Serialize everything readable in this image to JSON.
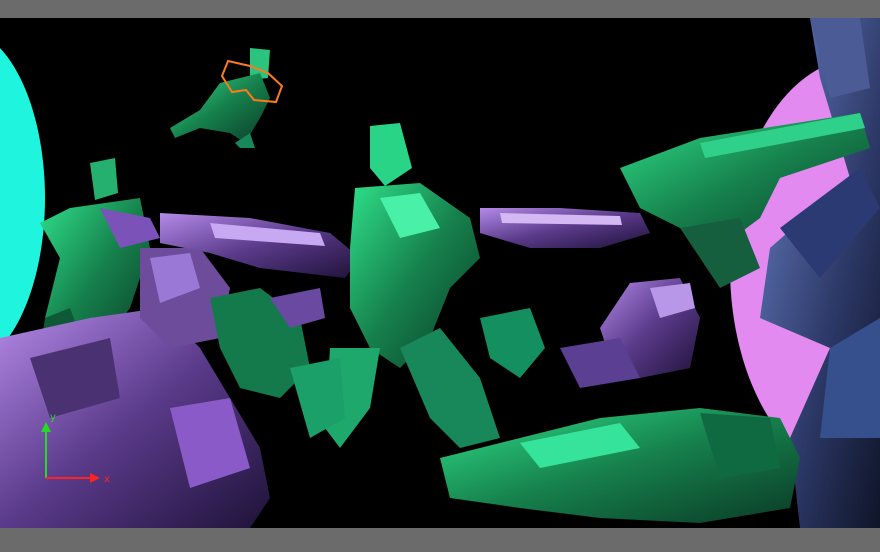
{
  "viewport": {
    "background": "#000000",
    "letterbox_color": "#6b6b6b"
  },
  "scene": {
    "left_disc_color": "#1ff5de",
    "right_disc_color": "#e28af0",
    "figure_green": "#1fa864",
    "figure_purple": "#7a4fb0",
    "figure_blue": "#3d4f8a",
    "selection_outline_color": "#ff7a1a"
  },
  "gizmo": {
    "y_axis_label": "y",
    "x_axis_label": "x",
    "y_axis_color": "#22dd22",
    "x_axis_color": "#ff2222"
  }
}
